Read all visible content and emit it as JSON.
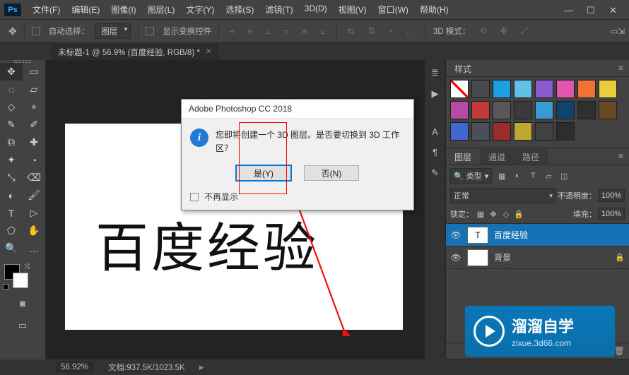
{
  "menu": [
    "文件(F)",
    "编辑(E)",
    "图像(I)",
    "图层(L)",
    "文字(Y)",
    "选择(S)",
    "滤镜(T)",
    "3D(D)",
    "视图(V)",
    "窗口(W)",
    "帮助(H)"
  ],
  "optbar": {
    "auto_select": "自动选择：",
    "target": "图层",
    "show_transform": "显示变换控件",
    "mode3d": "3D 模式："
  },
  "doc": {
    "tab": "未标题-1 @ 56.9% (百度经验, RGB/8) *"
  },
  "tools": [
    "✥",
    "▭",
    "◌",
    "▱",
    "◇",
    "⌖",
    "✎",
    "✐",
    "⧉",
    "✚",
    "✦",
    "◔",
    "⤡",
    "⌫",
    "◐",
    "🖌",
    "▮",
    "⬚",
    "✒",
    "T",
    "▷",
    "⬠",
    "✋",
    "🔍",
    "…",
    "⋯"
  ],
  "canvas": {
    "text": "百度经验"
  },
  "rstrip_icons": [
    "≣",
    "▶",
    "A",
    "¶",
    "✎"
  ],
  "styles": {
    "tab": "样式",
    "colors": [
      "noline",
      "#4a4a4a",
      "#1aa0e0",
      "#63c0e6",
      "#8a5ad0",
      "#e055b0",
      "#f07336",
      "#e8ce3a",
      "#b74aa4",
      "#c33a3a",
      "#585858",
      "#3a3a3a",
      "#3b9ad2",
      "#11436b",
      "#2f2f2f",
      "#6a4a23",
      "#4068d0",
      "#4a5055",
      "#9a2e2e",
      "#c0a830",
      "#424242",
      "#2d2d2d"
    ]
  },
  "layers": {
    "tabs": [
      "图层",
      "通道",
      "路径"
    ],
    "kind": "类型",
    "blend": "正常",
    "opacity_label": "不透明度：",
    "opacity": "100%",
    "lock_label": "锁定：",
    "fill_label": "填充：",
    "fill": "100%",
    "items": [
      {
        "name": "百度经验",
        "thumb": "T",
        "selected": true
      },
      {
        "name": "背景",
        "thumb": "bg",
        "lock": true
      }
    ]
  },
  "dialog": {
    "title": "Adobe Photoshop CC 2018",
    "msg": "您即将创建一个 3D 图层。是否要切换到 3D 工作区？",
    "yes": "是(Y)",
    "no": "否(N)",
    "dontshow": "不再显示"
  },
  "status": {
    "zoom": "56.92%",
    "doc": "文档:937.5K/1023.5K"
  },
  "brand": {
    "name": "溜溜自学",
    "url": "zixue.3d66.com"
  }
}
